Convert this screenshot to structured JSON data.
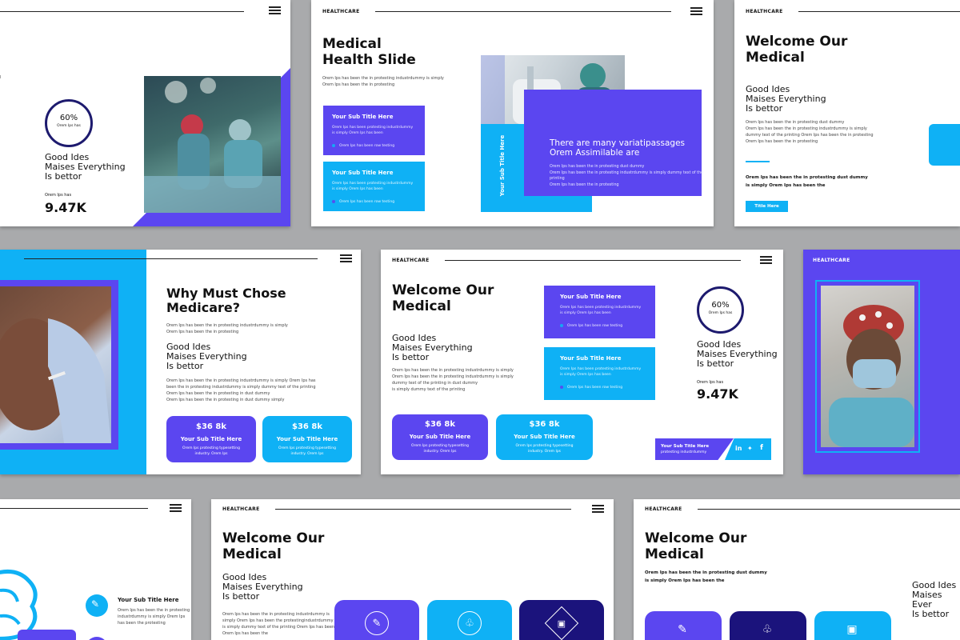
{
  "brand": "HEALTHCARE",
  "s1": {
    "stat_pct": "60%",
    "stat_sub": "Orem Ips has",
    "heading": [
      "Good Ides",
      "Maises Everything",
      "Is bettor"
    ],
    "small": "Orem Ips has",
    "big_number": "9.47K"
  },
  "s2": {
    "title": [
      "Medical",
      "Health Slide"
    ],
    "intro": [
      "Orem Ips has been the in protesting industrdummy is simply",
      "Orem Ips has been the in protesting"
    ],
    "card1_title": "Your Sub Title Here",
    "card1_desc": [
      "Orem Ips has been protesting industrdummy",
      "is simply Orem Ips has been"
    ],
    "card1_bullet": "Orem Ips has been row testing",
    "card2_title": "Your Sub Title Here",
    "card2_desc": [
      "Orem Ips has been protesting industrdummy",
      "is simply Orem Ips has been"
    ],
    "card2_bullet": "Orem Ips has been row testing",
    "vertical_label": "Your Sub Title Here",
    "panel_title": [
      "There are many variatipassages",
      "Orem Assimilable are"
    ],
    "panel_desc": [
      "Orem Ips has been the in protesting dust dummy",
      "Orem Ips has been the in protesting industrdummy is simply dummy text of the printing",
      "Orem Ips has been the in protesting"
    ]
  },
  "s3": {
    "title": [
      "Welcome Our",
      "Medical"
    ],
    "heading": [
      "Good Ides",
      "Maises Everything",
      "Is bettor"
    ],
    "desc": [
      "Orem Ips has been the in protesting dust dummy",
      "Orem Ips has been the in protesting industrdummy is simply",
      "dummy text of the printing Orem Ips has been the in protesting",
      "Orem Ips has been the in protesting"
    ],
    "bold_text": [
      "Orem Ips has been the in protesting dust dummy",
      "is simply Orem Ips has been the"
    ],
    "button": "Title Here"
  },
  "s4": {
    "title": [
      "Why Must Chose",
      "Medicare?"
    ],
    "intro": [
      "Orem Ips has been the in protesting industrdummy is simply",
      "Orem Ips has been the in protesting"
    ],
    "heading": [
      "Good Ides",
      "Maises Everything",
      "Is bettor"
    ],
    "desc": [
      "Orem Ips has been the in protesting industrdummy is simply Orem Ips has",
      "been the in protesting industrdummy is simply dummy text of the printing",
      "Orem Ips has been the in protesting in dust dummy",
      "Orem Ips has been the in protesting in dust dummy simply"
    ],
    "card1_value": "$36 8k",
    "card1_title": "Your Sub Title Here",
    "card1_desc": [
      "Orem Ips protesting typesetting",
      "industry. Orem Ips"
    ],
    "card2_value": "$36 8k",
    "card2_title": "Your Sub Title Here",
    "card2_desc": [
      "Orem Ips protesting typesetting",
      "industry. Orem Ips"
    ]
  },
  "s5": {
    "title": [
      "Welcome Our",
      "Medical"
    ],
    "heading": [
      "Good Ides",
      "Maises Everything",
      "Is bettor"
    ],
    "desc": [
      "Orem Ips has been the in protesting industrdummy is simply",
      "Orem Ips has been the in protesting industrdummy is simply",
      "dummy text of the printing in dust dummy",
      "is simply dummy text of the printing"
    ],
    "card1_title": "Your Sub Title Here",
    "card1_desc": [
      "Orem Ips has been protesting industrdummy",
      "is simply Orem Ips has been"
    ],
    "card1_bullet": "Orem Ips has been row testing",
    "card2_title": "Your Sub Title Here",
    "card2_desc": [
      "Orem Ips has been protesting industrdummy",
      "is simply Orem Ips has been"
    ],
    "card2_bullet": "Orem Ips has been row testing",
    "stat_pct": "60%",
    "stat_sub": "Orem Ips has",
    "heading2": [
      "Good Ides",
      "Maises Everything",
      "Is bettor"
    ],
    "small": "Orem Ips has",
    "big_number": "9.47K",
    "btn1_value": "$36 8k",
    "btn1_title": "Your Sub Title Here",
    "btn1_desc": [
      "Orem Ips protesting typesetting",
      "industry. Orem Ips"
    ],
    "btn2_value": "$36 8k",
    "btn2_title": "Your Sub Title Here",
    "btn2_desc": [
      "Orem Ips protesting typesetting",
      "industry. Orem Ips"
    ],
    "footer_title": "Your Sub Title Here",
    "footer_sub": "protesting industrdummy"
  },
  "s7": {
    "item_title": "Your Sub Title Here",
    "item_desc": [
      "Orem Ips has been the in protesting",
      "industrdummy is simply Orem Ips",
      "has been the protesting"
    ]
  },
  "s8": {
    "title": [
      "Welcome Our",
      "Medical"
    ],
    "heading": [
      "Good Ides",
      "Maises Everything",
      "Is bettor"
    ],
    "desc": [
      "Orem Ips has been the in protesting industrdummy is",
      "simply Orem Ips has been the protestingindustrdummy",
      "is simply dummy text of the printing Orem Ips has been",
      "Orem Ips has been the"
    ]
  },
  "s9": {
    "title": [
      "Welcome Our",
      "Medical"
    ],
    "bold_text": [
      "Orem Ips has been the in protesting dust dummy",
      "is simply Orem Ips has been the"
    ],
    "heading": [
      "Good Ides",
      "Maises Ever",
      "Is bettor"
    ]
  },
  "colors": {
    "purple": "#5b46f0",
    "cyan": "#0fb1f5",
    "navy": "#1b137c",
    "background": "#a9aaac"
  }
}
